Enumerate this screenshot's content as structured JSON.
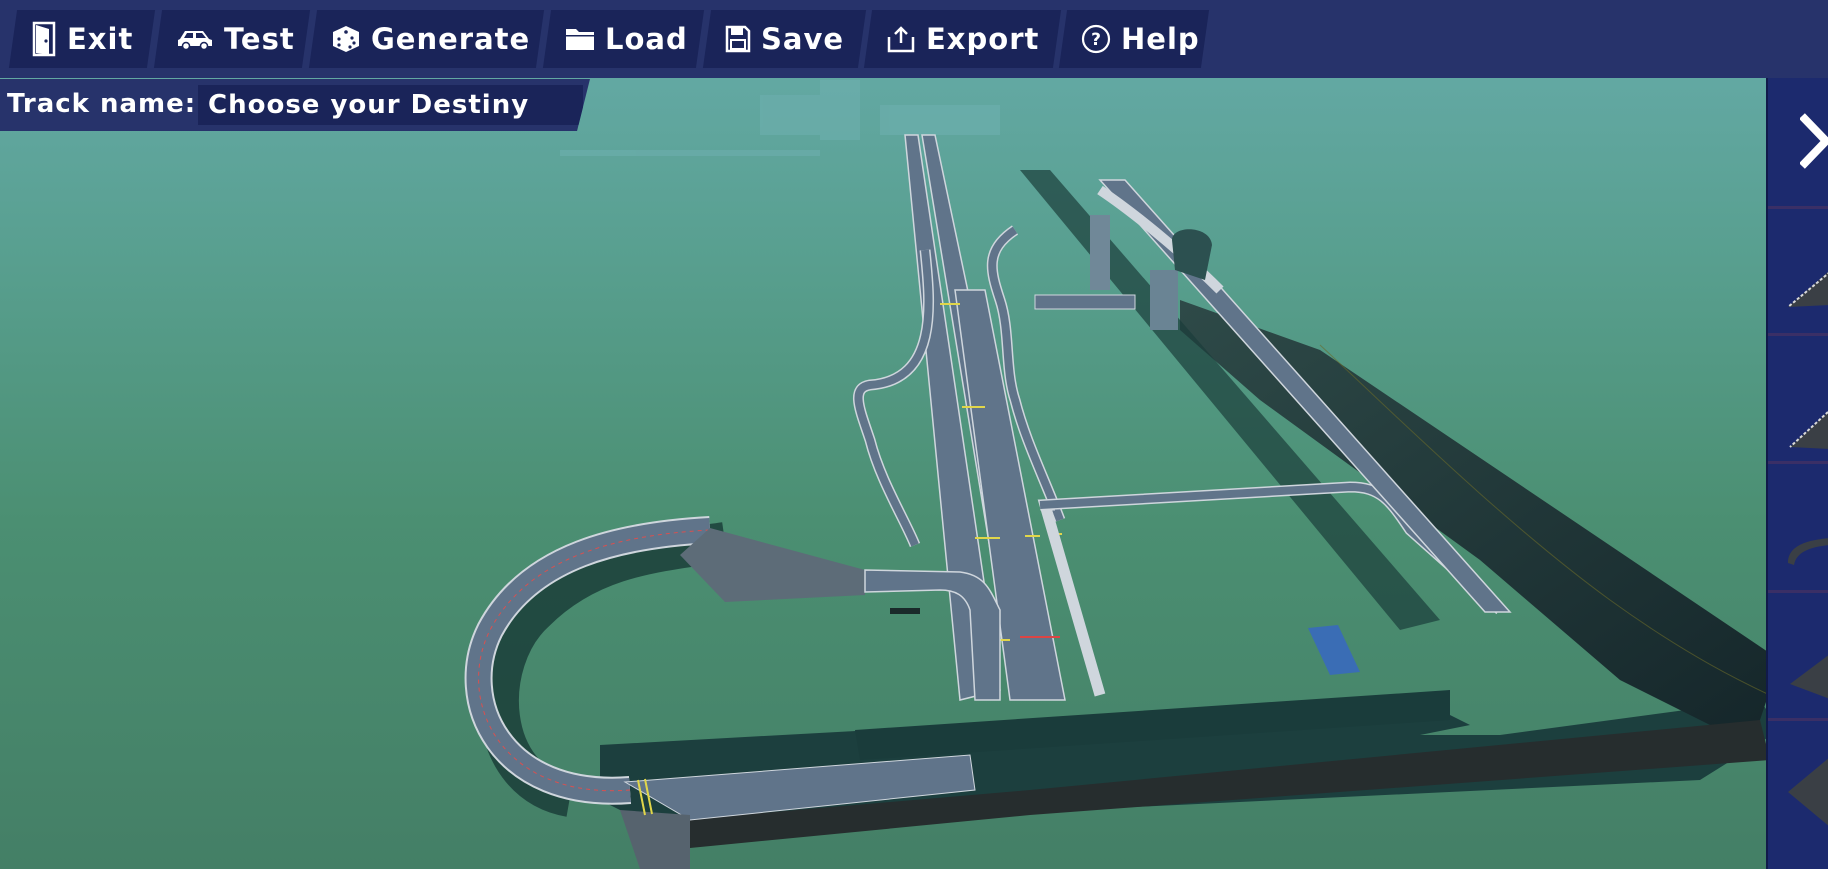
{
  "toolbar": {
    "buttons": [
      {
        "label": "Exit",
        "icon": "door-icon"
      },
      {
        "label": "Test",
        "icon": "car-icon"
      },
      {
        "label": "Generate",
        "icon": "dice-icon"
      },
      {
        "label": "Load",
        "icon": "folder-icon"
      },
      {
        "label": "Save",
        "icon": "floppy-icon"
      },
      {
        "label": "Export",
        "icon": "share-icon"
      },
      {
        "label": "Help",
        "icon": "help-circle-icon"
      }
    ]
  },
  "track": {
    "label": "Track name:",
    "name": "Choose your Destiny"
  },
  "palette": {
    "collapse_icon": "chevron-right-icon",
    "pieces": [
      "track-curve-piece",
      "track-curve-piece-2",
      "track-arc-piece",
      "track-ramp-piece",
      "track-wedge-piece"
    ]
  },
  "colors": {
    "toolbar_bg": "#27336b",
    "button_bg": "#1a2459",
    "sky_top": "#65aaa9",
    "ground": "#478a6a",
    "road": "#5f7286",
    "shadow": "#183a36",
    "palette_bg": "#1c2a6e"
  }
}
